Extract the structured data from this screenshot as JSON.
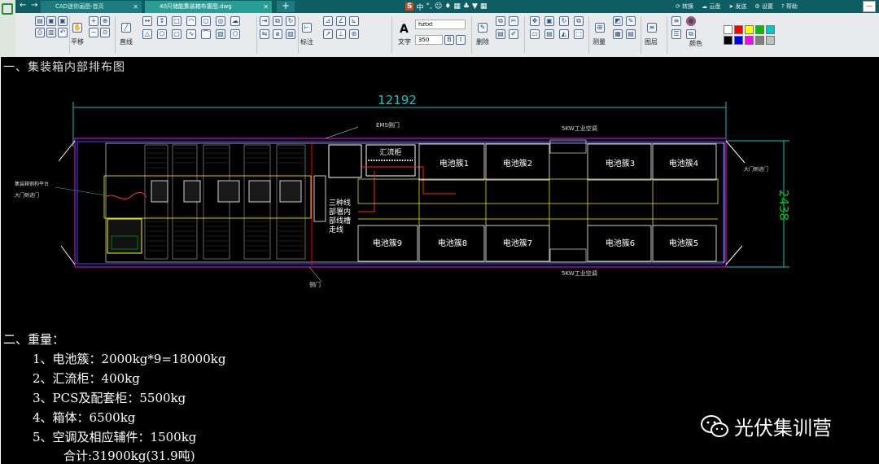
{
  "tabs": [
    {
      "label": "CAD迷你画图-首页"
    },
    {
      "label": "40尺储能集装箱布置图.dwg"
    }
  ],
  "ime": {
    "brand": "S",
    "lang": "中"
  },
  "header_nav": [
    {
      "label": "转换"
    },
    {
      "label": "云盘"
    },
    {
      "label": "发送"
    },
    {
      "label": "设置"
    },
    {
      "label": "帮助"
    }
  ],
  "toolbar": {
    "pan_label": "平移",
    "line_label": "直线",
    "dim_label": "标注",
    "text_label": "文字",
    "delete_label": "删除",
    "measure_label": "测量",
    "layer_label": "图层",
    "color_label": "颜色",
    "font_name": "hztxt",
    "font_size": "350",
    "colors": [
      "#ffffff",
      "#ff0000",
      "#ffff00",
      "#00c000",
      "#00c8c8",
      "#000000",
      "#0000ff",
      "#ff00ff",
      "#808080",
      "#c0c0c0"
    ]
  },
  "drawing": {
    "heading": "一、集装箱内部排布图",
    "dim_length": "12192",
    "dim_width": "2438",
    "ems_door": "EMS侧门",
    "ac_top": "5KW工业空调",
    "ac_bottom": "5KW工业空调",
    "combiner": "汇流柜",
    "cable_note": "三种线 部署内 部线槽 走线",
    "left_note1": "集装箱钢构平台",
    "left_note2": "大门侧进门",
    "right_note": "大门侧进门",
    "bottom_door": "侧门",
    "clusters": [
      "电池簇1",
      "电池簇2",
      "电池簇3",
      "电池簇4",
      "电池簇5",
      "电池簇6",
      "电池簇7",
      "电池簇8",
      "电池簇9"
    ]
  },
  "weights": {
    "title": "二、重量：",
    "items": [
      "1、电池簇：2000kg*9=18000kg",
      "2、汇流柜：400kg",
      "3、PCS及配套柜：5500kg",
      "4、箱体：6500kg",
      "5、空调及相应辅件：1500kg"
    ],
    "total": "合计:31900kg(31.9吨)"
  },
  "watermark": "光伏集训营"
}
